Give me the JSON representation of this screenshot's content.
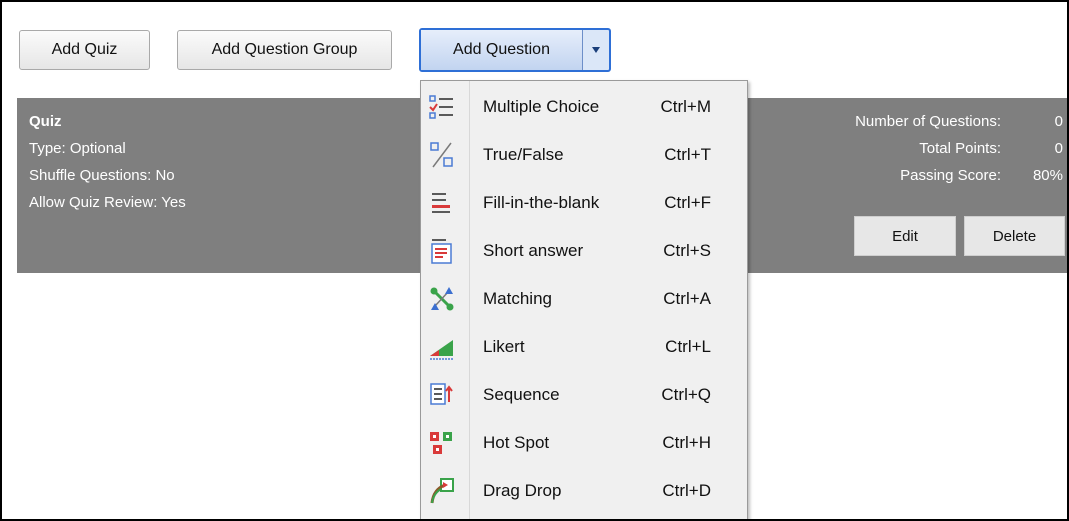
{
  "toolbar": {
    "add_quiz": "Add Quiz",
    "add_question_group": "Add Question Group",
    "add_question": "Add Question"
  },
  "quiz": {
    "title": "Quiz",
    "type": "Type: Optional",
    "shuffle": "Shuffle Questions: No",
    "review": "Allow Quiz Review: Yes",
    "stats": [
      {
        "label": "Number of Questions:",
        "value": "0"
      },
      {
        "label": "Total Points:",
        "value": "0"
      },
      {
        "label": "Passing Score:",
        "value": "80%"
      }
    ],
    "edit_label": "Edit",
    "delete_label": "Delete"
  },
  "menu": {
    "items": [
      {
        "label": "Multiple Choice",
        "shortcut": "Ctrl+M",
        "icon": "multiple-choice-icon"
      },
      {
        "label": "True/False",
        "shortcut": "Ctrl+T",
        "icon": "true-false-icon"
      },
      {
        "label": "Fill-in-the-blank",
        "shortcut": "Ctrl+F",
        "icon": "fill-in-the-blank-icon"
      },
      {
        "label": "Short answer",
        "shortcut": "Ctrl+S",
        "icon": "short-answer-icon"
      },
      {
        "label": "Matching",
        "shortcut": "Ctrl+A",
        "icon": "matching-icon"
      },
      {
        "label": "Likert",
        "shortcut": "Ctrl+L",
        "icon": "likert-icon"
      },
      {
        "label": "Sequence",
        "shortcut": "Ctrl+Q",
        "icon": "sequence-icon"
      },
      {
        "label": "Hot Spot",
        "shortcut": "Ctrl+H",
        "icon": "hot-spot-icon"
      },
      {
        "label": "Drag Drop",
        "shortcut": "Ctrl+D",
        "icon": "drag-drop-icon"
      }
    ]
  },
  "colors": {
    "panel_bg": "#7f7f7f",
    "accent_blue": "#2e6fd6",
    "menu_bg": "#f0f0f0"
  }
}
